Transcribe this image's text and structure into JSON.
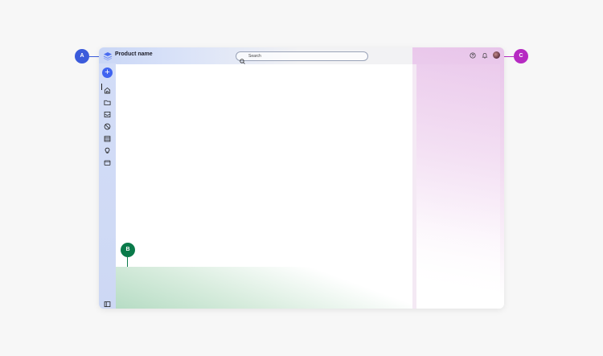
{
  "header": {
    "product_name": "Product name",
    "search_placeholder": "Search"
  },
  "callouts": [
    {
      "label": "A",
      "color": "#3b5bdb"
    },
    {
      "label": "B",
      "color": "#0a7a4a"
    },
    {
      "label": "C",
      "color": "#b62bc2"
    }
  ],
  "sidebar": {
    "items": [
      {
        "icon": "add-icon"
      },
      {
        "icon": "home-icon"
      },
      {
        "icon": "folder-icon"
      },
      {
        "icon": "inbox-icon"
      },
      {
        "icon": "blocked-icon"
      },
      {
        "icon": "calendar-icon"
      },
      {
        "icon": "lightbulb-icon"
      },
      {
        "icon": "window-icon"
      },
      {
        "icon": "panel-toggle-icon"
      }
    ]
  },
  "colors": {
    "accent": "#3f63f0",
    "left_gradient": "#c9d6f6",
    "bottom_gradient": "#b6dcc4",
    "right_gradient": "#e8c5ea"
  }
}
